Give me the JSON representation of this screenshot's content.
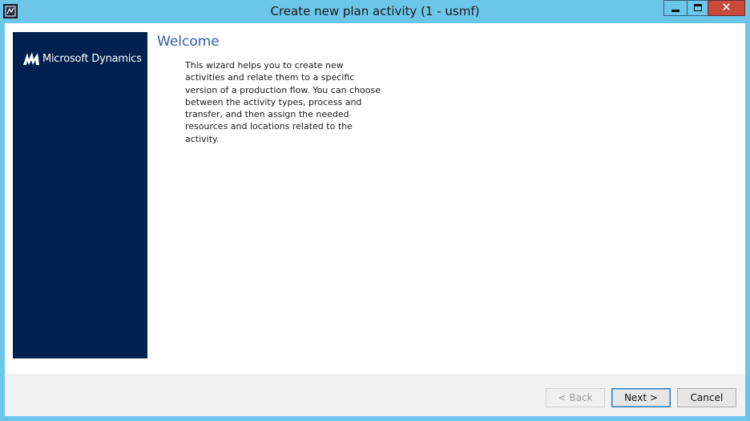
{
  "window": {
    "title": "Create new plan activity (1 - usmf)",
    "close_glyph": "✕"
  },
  "brand": {
    "name": "Microsoft Dynamics",
    "icon": "microsoft-dynamics-logo"
  },
  "content": {
    "heading": "Welcome",
    "description": "This wizard helps you to create new activities and relate them to a specific version of a production flow. You can choose between the activity types, process and transfer, and then assign the needed resources and locations related to the activity."
  },
  "buttons": {
    "back": "< Back",
    "next": "Next >",
    "cancel": "Cancel"
  },
  "colors": {
    "titlebar": "#6cc6ea",
    "side_panel": "#002050",
    "heading": "#2e5fa6",
    "close_button": "#c64a3b"
  }
}
